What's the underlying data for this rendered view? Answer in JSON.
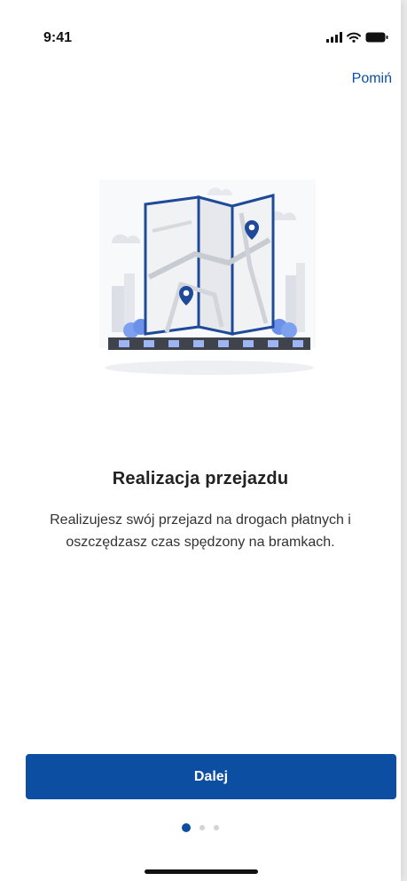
{
  "status_bar": {
    "time": "9:41",
    "icons": [
      "signal-icon",
      "wifi-icon",
      "battery-icon"
    ]
  },
  "header": {
    "skip_label": "Pomiń"
  },
  "onboarding": {
    "illustration": "map-with-pins-icon",
    "title": "Realizacja przejazdu",
    "description": "Realizujesz swój przejazd na drogach płatnych i oszczędzasz czas spędzony na bramkach."
  },
  "footer": {
    "next_label": "Dalej",
    "pagination": {
      "current": 1,
      "total": 3
    }
  },
  "colors": {
    "accent": "#0b4ea2",
    "inactive_dot": "#d2d4d8"
  }
}
